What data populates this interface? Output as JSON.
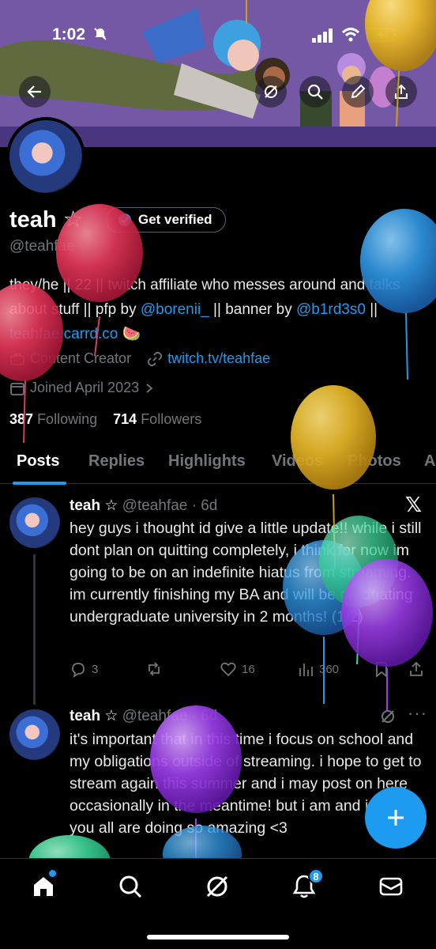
{
  "status_bar": {
    "time": "1:02"
  },
  "header_buttons": [
    "back",
    "grok",
    "search",
    "edit",
    "share"
  ],
  "profile": {
    "name": "teah ☆",
    "handle": "@teahfae",
    "get_verified": "Get verified",
    "bio_text_1": "they/he || 22 || twitch affiliate who messes around and talks about stuff || pfp by ",
    "bio_link_1": "@borenii_",
    "bio_text_2": " || banner by ",
    "bio_link_2": "@b1rd3s0",
    "bio_text_3": " || ",
    "bio_link_3": "teahfae.carrd.co",
    "bio_emoji": "🍉",
    "category": "Content Creator",
    "website": "twitch.tv/teahfae",
    "joined": "Joined April 2023",
    "following_count": "387",
    "following_label": "Following",
    "followers_count": "714",
    "followers_label": "Followers"
  },
  "tabs": [
    "Posts",
    "Replies",
    "Highlights",
    "Videos",
    "Photos",
    "A"
  ],
  "tweets": [
    {
      "name": "teah ☆",
      "handle_time": "@teahfae · 6d",
      "text": "hey guys i thought id give a little update!! while i still dont plan on quitting completely, i think for now im going to be on an indefinite hiatus from streaming.  im currently finishing my BA and will be graduating undergraduate university in 2 months! (1/2)",
      "replies": "3",
      "likes": "16",
      "views": "360"
    },
    {
      "name": "teah ☆",
      "handle_time": "@teahfae · 6d",
      "text": "it's important that in this time i focus on school and my obligations outside of streaming.  i hope to get to stream again this summer and i may post on here occasionally in the meantime!  but i am and i hope you all are doing so amazing <3"
    }
  ],
  "bottom_nav": {
    "notifications_badge": "8"
  },
  "colors": {
    "accent": "#1d9bf0",
    "background": "#000000",
    "muted": "#71767b"
  }
}
